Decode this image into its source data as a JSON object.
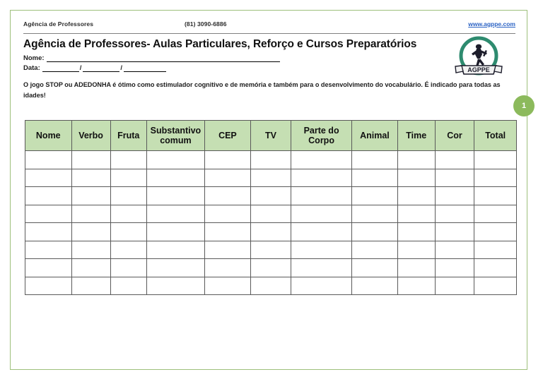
{
  "running_header": {
    "left_text": "Agência de Professores",
    "phone": "(81) 3090-6886",
    "website": "www.agppe.com"
  },
  "document": {
    "title": "Agência de Professores- Aulas Particulares, Reforço e Cursos Preparatórios",
    "name_label": "Nome:",
    "date_label": "Data:",
    "date_separator": "/",
    "intro_paragraph": "O jogo STOP ou ADEDONHA é ótimo como estimulador cognitivo e de memória e também para o desenvolvimento do vocabulário. É indicado para todas as idades!"
  },
  "logo": {
    "banner_text": "AGPPE",
    "ring_color": "#2e8b6f",
    "figure_color": "#1d1d2b"
  },
  "page_badge": {
    "number": "1",
    "color": "#8cba5c"
  },
  "table": {
    "header_fill": "#c5dfb3",
    "border_color": "#5a5a5a",
    "columns": [
      "Nome",
      "Verbo",
      "Fruta",
      "Substantivo comum",
      "CEP",
      "TV",
      "Parte do Corpo",
      "Animal",
      "Time",
      "Cor",
      "Total"
    ],
    "column_widths": [
      "8.7%",
      "7.3%",
      "6.8%",
      "10.9%",
      "8.6%",
      "7.6%",
      "11.4%",
      "8.6%",
      "7.0%",
      "7.4%",
      "7.9%"
    ],
    "body_row_count": 8,
    "body_rows": [
      [
        "",
        "",
        "",
        "",
        "",
        "",
        "",
        "",
        "",
        "",
        ""
      ],
      [
        "",
        "",
        "",
        "",
        "",
        "",
        "",
        "",
        "",
        "",
        ""
      ],
      [
        "",
        "",
        "",
        "",
        "",
        "",
        "",
        "",
        "",
        "",
        ""
      ],
      [
        "",
        "",
        "",
        "",
        "",
        "",
        "",
        "",
        "",
        "",
        ""
      ],
      [
        "",
        "",
        "",
        "",
        "",
        "",
        "",
        "",
        "",
        "",
        ""
      ],
      [
        "",
        "",
        "",
        "",
        "",
        "",
        "",
        "",
        "",
        "",
        ""
      ],
      [
        "",
        "",
        "",
        "",
        "",
        "",
        "",
        "",
        "",
        "",
        ""
      ],
      [
        "",
        "",
        "",
        "",
        "",
        "",
        "",
        "",
        "",
        "",
        ""
      ]
    ]
  },
  "page_border_color": "#9ec07c"
}
